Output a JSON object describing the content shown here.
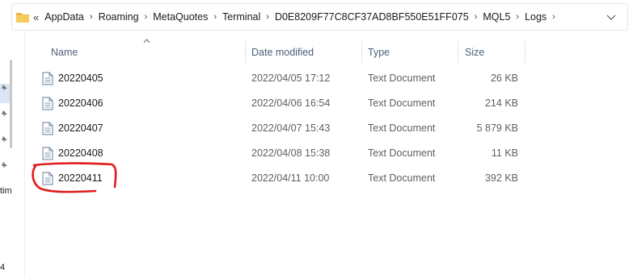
{
  "address_bar": {
    "lead": "«",
    "crumbs": [
      "AppData",
      "Roaming",
      "MetaQuotes",
      "Terminal",
      "D0E8209F77C8CF37AD8BF550E51FF075",
      "MQL5",
      "Logs"
    ],
    "icon": "folder-icon",
    "dropdown_icon": "chevron-down-icon"
  },
  "nav_pane": {
    "partial_text_1": "tim",
    "partial_text_2": "4"
  },
  "columns": {
    "name": "Name",
    "date": "Date modified",
    "type": "Type",
    "size": "Size"
  },
  "files": [
    {
      "name": "20220405",
      "date": "2022/04/05 17:12",
      "type": "Text Document",
      "size": "26 KB"
    },
    {
      "name": "20220406",
      "date": "2022/04/06 16:54",
      "type": "Text Document",
      "size": "214 KB"
    },
    {
      "name": "20220407",
      "date": "2022/04/07 15:43",
      "type": "Text Document",
      "size": "5 879 KB"
    },
    {
      "name": "20220408",
      "date": "2022/04/08 15:38",
      "type": "Text Document",
      "size": "11 KB"
    },
    {
      "name": "20220411",
      "date": "2022/04/11 10:00",
      "type": "Text Document",
      "size": "392 KB",
      "highlighted": true
    }
  ],
  "colors": {
    "header_text": "#4c607a",
    "folder": "#e8b94a",
    "annotation": "#e01b1b",
    "selection": "#d9e6f5"
  }
}
